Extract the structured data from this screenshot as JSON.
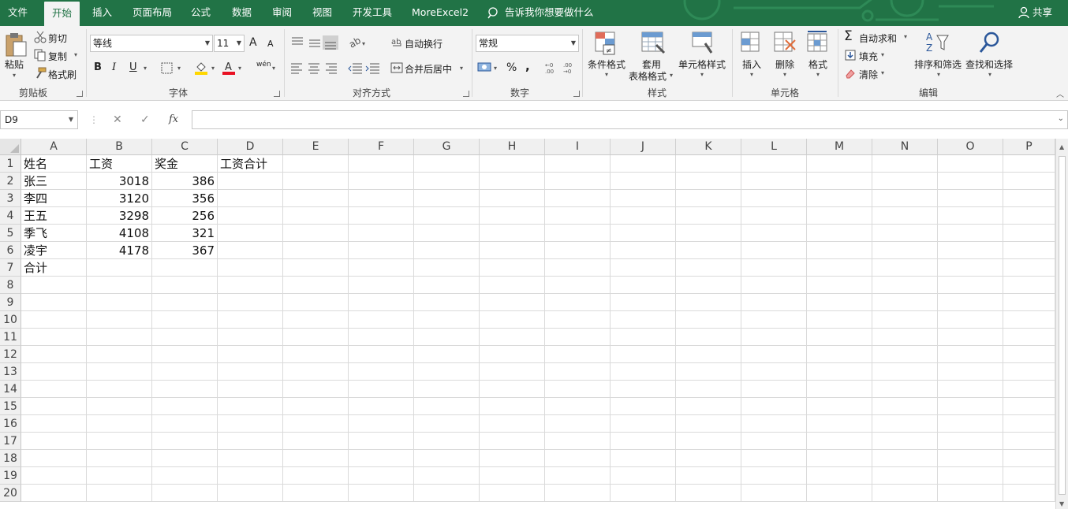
{
  "tabs": [
    "文件",
    "开始",
    "插入",
    "页面布局",
    "公式",
    "数据",
    "审阅",
    "视图",
    "开发工具",
    "MoreExcel2"
  ],
  "active_tab": "开始",
  "tell_me": "告诉我你想要做什么",
  "share": "共享",
  "clipboard": {
    "paste": "粘贴",
    "cut": "剪切",
    "copy": "复制",
    "format_painter": "格式刷",
    "group": "剪贴板"
  },
  "font": {
    "name": "等线",
    "size": "11",
    "bold": "B",
    "italic": "I",
    "underline": "U",
    "grow": "A",
    "shrink": "A",
    "phonetic": "wén",
    "group": "字体",
    "fill_color": "#ffd700",
    "font_color": "#e81123"
  },
  "alignment": {
    "wrap_text": "自动换行",
    "merge_center": "合并后居中",
    "group": "对齐方式"
  },
  "number": {
    "format": "常规",
    "percent": "%",
    "comma": ",",
    "group": "数字"
  },
  "styles": {
    "conditional": "条件格式",
    "format_table_1": "套用",
    "format_table_2": "表格格式",
    "cell_styles": "单元格样式",
    "group": "样式"
  },
  "cells": {
    "insert": "插入",
    "delete": "删除",
    "format": "格式",
    "group": "单元格"
  },
  "editing": {
    "autosum": "自动求和",
    "fill": "填充",
    "clear": "清除",
    "sort_filter": "排序和筛选",
    "find_select": "查找和选择",
    "group": "编辑"
  },
  "formula_bar": {
    "name_box": "D9",
    "fx": "fx",
    "cancel": "✕",
    "enter": "✓",
    "value": ""
  },
  "columns": [
    "A",
    "B",
    "C",
    "D",
    "E",
    "F",
    "G",
    "H",
    "I",
    "J",
    "K",
    "L",
    "M",
    "N",
    "O",
    "P"
  ],
  "rows": [
    "1",
    "2",
    "3",
    "4",
    "5",
    "6",
    "7",
    "8",
    "9",
    "10",
    "11",
    "12",
    "13",
    "14",
    "15",
    "16",
    "17",
    "18",
    "19",
    "20"
  ],
  "cells_data": [
    [
      "姓名",
      "工资",
      "奖金",
      "工资合计"
    ],
    [
      "张三",
      "3018",
      "386",
      ""
    ],
    [
      "李四",
      "3120",
      "356",
      ""
    ],
    [
      "王五",
      "3298",
      "256",
      ""
    ],
    [
      "季飞",
      "4108",
      "321",
      ""
    ],
    [
      "凌宇",
      "4178",
      "367",
      ""
    ],
    [
      "合计",
      "",
      "",
      ""
    ]
  ],
  "colors": {
    "brand": "#217346",
    "ribbon_bg": "#f3f3f3",
    "grid_line": "#dadada"
  }
}
